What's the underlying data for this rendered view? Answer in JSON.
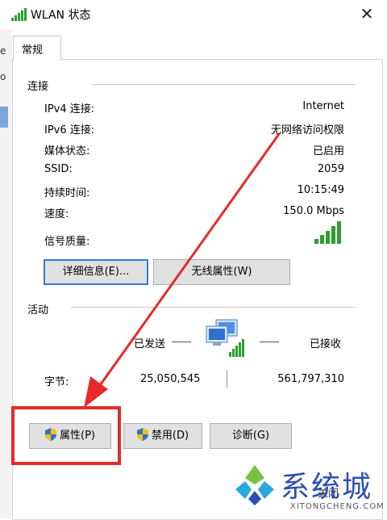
{
  "window": {
    "title": "WLAN 状态",
    "close_glyph": "✕"
  },
  "tab": {
    "label": "常规"
  },
  "connection": {
    "heading": "连接",
    "rows": [
      {
        "label": "IPv4 连接:",
        "value": "Internet"
      },
      {
        "label": "IPv6 连接:",
        "value": "无网络访问权限"
      },
      {
        "label": "媒体状态:",
        "value": "已启用"
      },
      {
        "label": "SSID:",
        "value": "2059"
      },
      {
        "label": "持续时间:",
        "value": "10:15:49"
      },
      {
        "label": "速度:",
        "value": "150.0 Mbps"
      }
    ],
    "signal_label": "信号质量:",
    "signal_bars": 5,
    "buttons": {
      "details": "详细信息(E)...",
      "wireless_props": "无线属性(W)"
    }
  },
  "activity": {
    "heading": "活动",
    "sent_label": "已发送",
    "received_label": "已接收",
    "bytes_label": "字节:",
    "bytes_sent": "25,050,545",
    "bytes_received": "561,797,310"
  },
  "bottom_buttons": {
    "properties": "属性(P)",
    "disable": "禁用(D)",
    "diagnose": "诊断(G)"
  },
  "partial_texts": {
    "left_edge_1": "e",
    "left_edge_2": "o",
    "bottom_right": "关闭"
  },
  "watermark": {
    "text": "系统城",
    "sub": "XITONGCHENG.COM"
  },
  "colors": {
    "highlight_red": "#e8292a",
    "signal_green": "#2e9e2e",
    "accent_blue": "#3b78d7"
  }
}
